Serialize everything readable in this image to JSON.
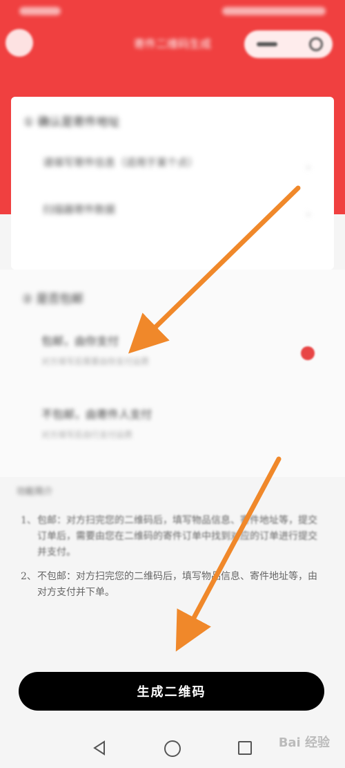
{
  "nav": {
    "title": "寄件二维码生成",
    "capsule_more": "•••"
  },
  "card": {
    "heading": "① 确认是寄件地址",
    "rows": [
      "请填写寄件信息（适用于某个点）",
      "扫描器寄件数据"
    ]
  },
  "section": {
    "heading": "② 是否包邮",
    "options": [
      {
        "title": "包邮，由你支付",
        "sub": "对方填写后需要由你支付运费",
        "selected": true
      },
      {
        "title": "不包邮，由寄件人支付",
        "sub": "对方填写后自行支付运费",
        "selected": false
      }
    ]
  },
  "notes": {
    "heading": "功能简介",
    "items": [
      {
        "num": "1、",
        "text": "包邮：对方扫完您的二维码后，填写物品信息、寄件地址等，提交订单后，需要由您在二维码的寄件订单中找到对应的订单进行提交并支付。"
      },
      {
        "num": "2、",
        "text": "不包邮：对方扫完您的二维码后，填写物品信息、寄件地址等，由对方支付并下单。"
      }
    ]
  },
  "button": {
    "generate_label": "生成二维码"
  },
  "watermark": "Bai 经验",
  "colors": {
    "header_red": "#f04040",
    "button_black": "#000000",
    "radio_red": "#e84545",
    "arrow_orange": "#f0882a"
  }
}
